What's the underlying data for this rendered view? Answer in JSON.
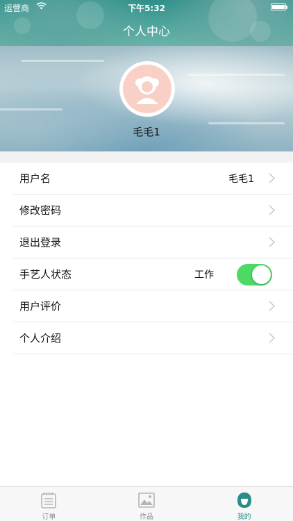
{
  "status_bar": {
    "carrier": "运营商",
    "time": "下午5:32"
  },
  "nav": {
    "title": "个人中心"
  },
  "profile": {
    "username": "毛毛1"
  },
  "settings": {
    "username_row": {
      "label": "用户名",
      "value": "毛毛1"
    },
    "password_row": {
      "label": "修改密码"
    },
    "logout_row": {
      "label": "退出登录"
    },
    "artisan_status_row": {
      "label": "手艺人状态",
      "toggle_label": "工作",
      "toggle_on": true
    },
    "reviews_row": {
      "label": "用户评价"
    },
    "intro_row": {
      "label": "个人介绍"
    }
  },
  "tabs": [
    {
      "label": "订单",
      "icon": "order-list-icon",
      "active": false
    },
    {
      "label": "作品",
      "icon": "image-gallery-icon",
      "active": false
    },
    {
      "label": "我的",
      "icon": "profile-avatar-icon",
      "active": true
    }
  ],
  "colors": {
    "accent": "#2e8d88",
    "toggle_on": "#4cd964",
    "avatar_bg": "#f8d0c6"
  }
}
